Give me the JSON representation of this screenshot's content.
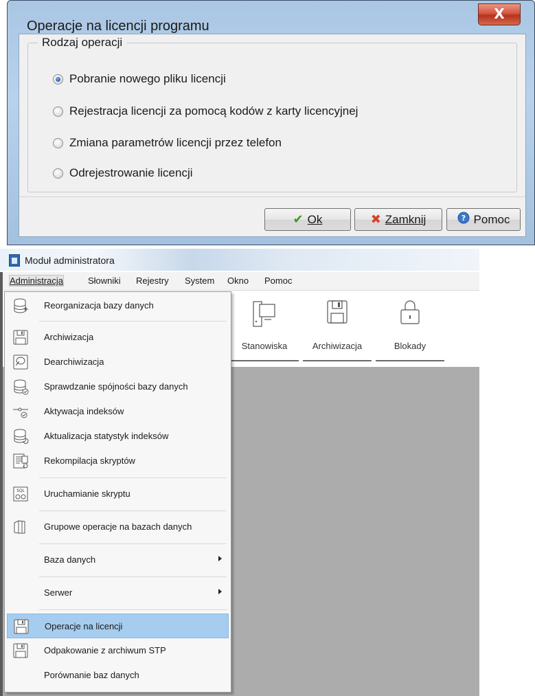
{
  "dialog": {
    "title": "Operacje na licencji programu",
    "close_glyph": "X",
    "group_label": "Rodzaj operacji",
    "options": [
      {
        "label": "Pobranie nowego pliku licencji",
        "checked": true
      },
      {
        "label": "Rejestracja licencji za pomocą kodów z karty licencyjnej",
        "checked": false
      },
      {
        "label": "Zmiana parametrów licencji przez telefon",
        "checked": false
      },
      {
        "label": "Odrejestrowanie licencji",
        "checked": false
      }
    ],
    "buttons": {
      "ok": {
        "label": "Ok",
        "icon": "checkmark-icon"
      },
      "close": {
        "label": "Zamknij",
        "icon": "x-icon"
      },
      "help": {
        "label": "Pomoc",
        "icon": "help-icon"
      }
    }
  },
  "app": {
    "title": "Moduł administratora",
    "menu": [
      "Administracja",
      "Słowniki",
      "Rejestry",
      "System",
      "Okno",
      "Pomoc"
    ],
    "toolbar": [
      {
        "label": "Stanowiska",
        "icon": "workstation-icon"
      },
      {
        "label": "Archiwizacja",
        "icon": "floppy-icon"
      },
      {
        "label": "Blokady",
        "icon": "lock-icon"
      }
    ],
    "dropdown": {
      "items": [
        {
          "label": "Reorganizacja bazy danych",
          "icon": "database-icon"
        },
        {
          "label": "Archiwizacja",
          "icon": "floppy-icon"
        },
        {
          "label": "Dearchiwizacja",
          "icon": "restore-icon"
        },
        {
          "label": "Sprawdzanie spójności bazy danych",
          "icon": "database-check-icon"
        },
        {
          "label": "Aktywacja indeksów",
          "icon": "index-key-icon"
        },
        {
          "label": "Aktualizacja statystyk indeksów",
          "icon": "database-refresh-icon"
        },
        {
          "label": "Rekompilacja skryptów",
          "icon": "script-compile-icon"
        },
        {
          "label": "Uruchamianie skryptu",
          "icon": "sql-run-icon"
        },
        {
          "label": "Grupowe operacje na bazach danych",
          "icon": "group-ops-icon"
        },
        {
          "label": "Baza danych",
          "icon": ""
        },
        {
          "label": "Serwer",
          "icon": ""
        },
        {
          "label": "Operacje na licencji",
          "icon": "floppy-icon"
        },
        {
          "label": "Odpakowanie z archiwum STP",
          "icon": "floppy-icon"
        },
        {
          "label": "Porównanie baz danych",
          "icon": ""
        }
      ]
    }
  }
}
